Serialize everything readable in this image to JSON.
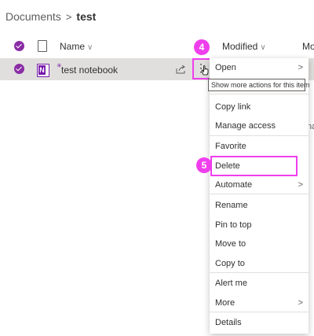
{
  "breadcrumb": {
    "root": "Documents",
    "separator": ">",
    "current": "test"
  },
  "list": {
    "columns": {
      "name": "Name",
      "modified": "Modified",
      "modified_by": "Mo"
    },
    "row": {
      "name": "test notebook",
      "modified_by": "na"
    }
  },
  "tooltip": "Show more actions for this item",
  "annotations": {
    "step4": "4",
    "step5": "5"
  },
  "menu": {
    "open": "Open",
    "copy_link": "Copy link",
    "manage_access": "Manage access",
    "favorite": "Favorite",
    "delete": "Delete",
    "automate": "Automate",
    "rename": "Rename",
    "pin_to_top": "Pin to top",
    "move_to": "Move to",
    "copy_to": "Copy to",
    "alert_me": "Alert me",
    "more": "More",
    "details": "Details"
  },
  "colors": {
    "accent": "#8a2da5",
    "highlight": "#ef3fed",
    "selected_row": "#e1dfdd",
    "onenote": "#7719aa"
  },
  "icons": {
    "sort": "chevron-down-icon",
    "submenu": "chevron-right-icon",
    "share": "share-icon",
    "more_actions": "more-dots-icon"
  }
}
